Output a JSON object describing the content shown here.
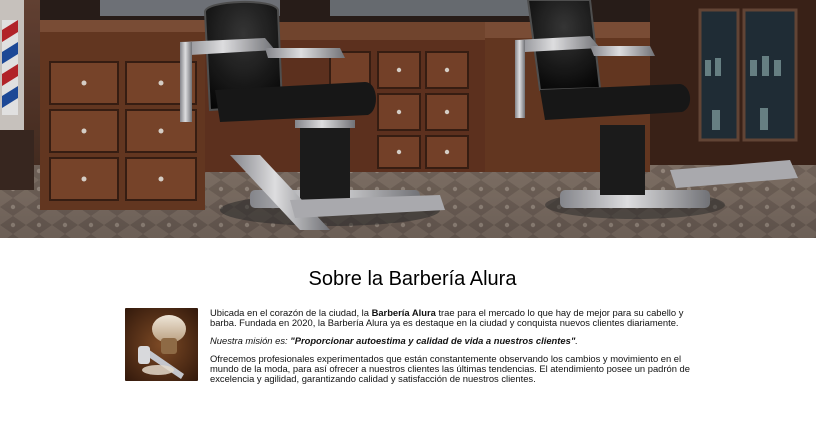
{
  "hero": {
    "image": "barbershop-interior-image",
    "colors": {
      "wood": "#5a3320",
      "chair_leather": "#111111",
      "chrome": "#bfbfc3",
      "floor": "#7b6f67"
    }
  },
  "about": {
    "title": "Sobre la Barbería Alura",
    "image": "shaving-brush-image",
    "p1_before": "Ubicada en el corazón de la ciudad, la ",
    "p1_strong": "Barbería Alura",
    "p1_after": " trae para el mercado lo que hay de mejor para su cabello y barba. Fundada en 2020, la Barbería Alura ya es destaque en la ciudad y conquista nuevos clientes diariamente.",
    "mission_label": "Nuestra misión es: ",
    "mission_text": "\"Proporcionar autoestima y calidad de vida a nuestros clientes\"",
    "mission_end": ".",
    "p3": "Ofrecemos profesionales experimentados que están constantemente observando los cambios y movimiento en el mundo de la moda, para así ofrecer a nuestros clientes las últimas tendencias. El atendimiento posee un padrón de excelencia y agilidad, garantizando calidad y satisfacción de nuestros clientes."
  }
}
